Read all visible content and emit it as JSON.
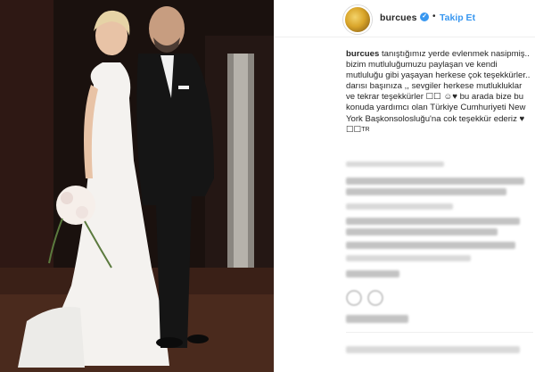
{
  "header": {
    "username": "burcues",
    "separator": "•",
    "follow_label": "Takip Et",
    "verified_icon": "verified-badge-icon",
    "accent_color": "#3897f0"
  },
  "caption": {
    "username": "burcues",
    "text": "tanıştığımız yerde evlenmek nasipmiş.. bizim mutluluğumuzu paylaşan ve kendi mutluluğu gibi yaşayan herkese çok teşekkürler.. darısı başınıza ,, sevgiler herkese mutlukluklar ve tekrar teşekkürler ☐☐ ☺♥ bu arada bize bu konuda yardımcı olan Türkiye Cumhuriyeti New York Başkonsolosluğu'na cok teşekkür ederiz ♥ ☐☐",
    "tr_mark": "TR"
  },
  "photo": {
    "description_icon": "wedding-photo"
  }
}
